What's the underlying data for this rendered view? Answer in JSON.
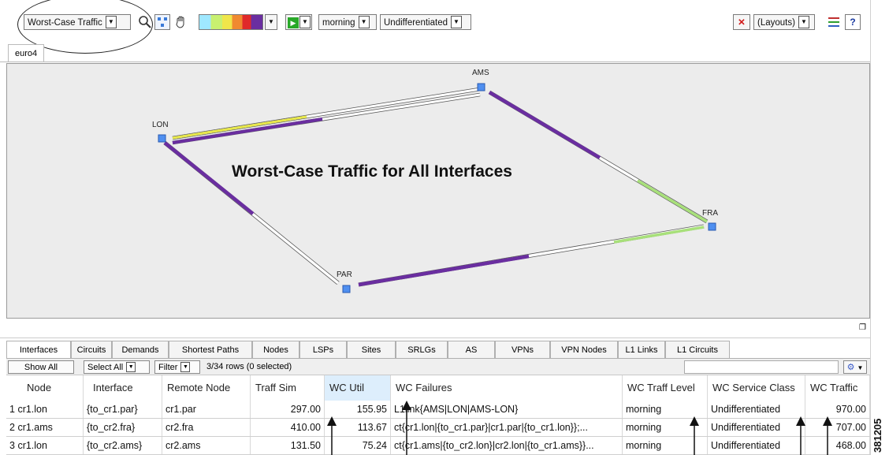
{
  "toolbar": {
    "traffic_view": "Worst-Case Traffic",
    "traffic_level": "morning",
    "service_class": "Undifferentiated",
    "layouts": "(Layouts)"
  },
  "doc_tab": "euro4",
  "map": {
    "title": "Worst-Case Traffic for All Interfaces",
    "nodes": [
      "AMS",
      "LON",
      "FRA",
      "PAR"
    ],
    "colors": {
      "purple": "#6a2ea0",
      "yellow": "#e8e84a",
      "lightgreen": "#a8e07a",
      "white": "#ffffff",
      "node": "#4f8ff0"
    }
  },
  "table_tabs": [
    "Interfaces",
    "Circuits",
    "Demands",
    "Shortest Paths",
    "Nodes",
    "LSPs",
    "Sites",
    "SRLGs",
    "AS",
    "VPNs",
    "VPN Nodes",
    "L1 Links",
    "L1 Circuits"
  ],
  "filterbar": {
    "show_all": "Show All",
    "select_all": "Select All",
    "filter": "Filter",
    "rows": "3/34 rows (0 selected)"
  },
  "columns": [
    "Node",
    "Interface",
    "Remote Node",
    "Traff Sim",
    "WC Util",
    "WC Failures",
    "WC Traff Level",
    "WC Service Class",
    "WC Traffic"
  ],
  "rows": [
    {
      "idx": "1",
      "node": "cr1.lon",
      "interface": "{to_cr1.par}",
      "remote": "cr1.par",
      "traff_sim": "297.00",
      "wc_util": "155.95",
      "wc_failures": "L1link{AMS|LON|AMS-LON}",
      "level": "morning",
      "service": "Undifferentiated",
      "wc_traffic": "970.00"
    },
    {
      "idx": "2",
      "node": "cr1.ams",
      "interface": "{to_cr2.fra}",
      "remote": "cr2.fra",
      "traff_sim": "410.00",
      "wc_util": "113.67",
      "wc_failures": "ct{cr1.lon|{to_cr1.par}|cr1.par|{to_cr1.lon}};...",
      "level": "morning",
      "service": "Undifferentiated",
      "wc_traffic": "707.00"
    },
    {
      "idx": "3",
      "node": "cr1.lon",
      "interface": "{to_cr2.ams}",
      "remote": "cr2.ams",
      "traff_sim": "131.50",
      "wc_util": "75.24",
      "wc_failures": "ct{cr1.ams|{to_cr2.lon}|cr2.lon|{to_cr1.ams}}...",
      "level": "morning",
      "service": "Undifferentiated",
      "wc_traffic": "468.00"
    }
  ],
  "figure_id": "381205"
}
